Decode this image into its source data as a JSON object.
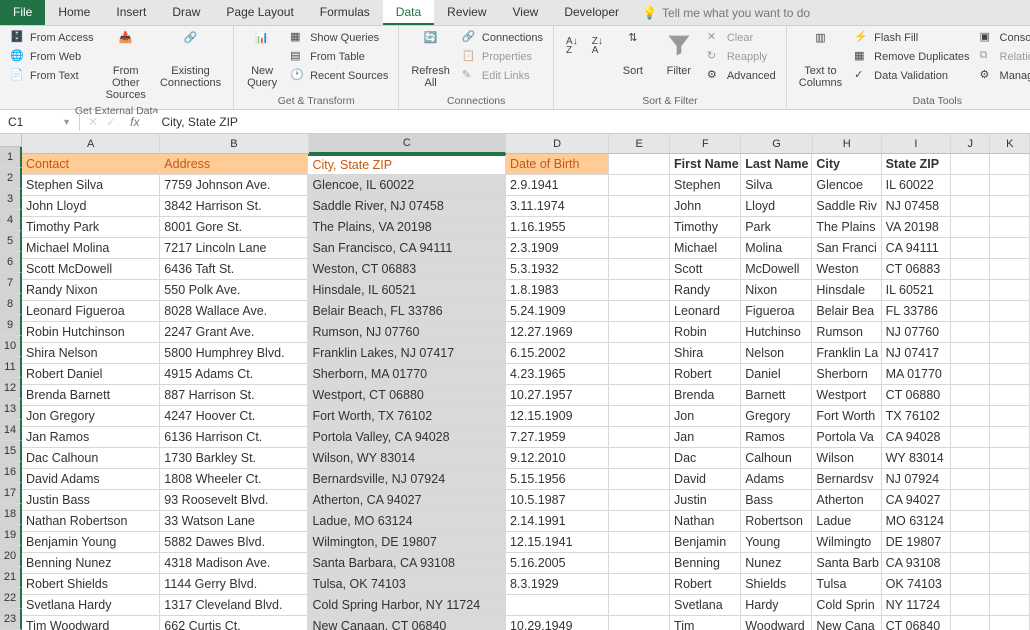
{
  "tabs": {
    "file": "File",
    "home": "Home",
    "insert": "Insert",
    "draw": "Draw",
    "pageLayout": "Page Layout",
    "formulas": "Formulas",
    "data": "Data",
    "review": "Review",
    "view": "View",
    "developer": "Developer",
    "tellMe": "Tell me what you want to do"
  },
  "ribbon": {
    "getExternal": {
      "label": "Get External Data",
      "fromAccess": "From Access",
      "fromWeb": "From Web",
      "fromText": "From Text",
      "fromOther": "From Other\nSources",
      "existing": "Existing\nConnections"
    },
    "getTransform": {
      "label": "Get & Transform",
      "newQuery": "New\nQuery",
      "showQueries": "Show Queries",
      "fromTable": "From Table",
      "recentSources": "Recent Sources"
    },
    "connections": {
      "label": "Connections",
      "refresh": "Refresh\nAll",
      "conn": "Connections",
      "props": "Properties",
      "editLinks": "Edit Links"
    },
    "sortFilter": {
      "label": "Sort & Filter",
      "sort": "Sort",
      "filter": "Filter",
      "clear": "Clear",
      "reapply": "Reapply",
      "advanced": "Advanced"
    },
    "dataTools": {
      "label": "Data Tools",
      "textToColumns": "Text to\nColumns",
      "flashFill": "Flash Fill",
      "removeDup": "Remove Duplicates",
      "validation": "Data Validation",
      "consolidate": "Consolidate",
      "relationships": "Relationships",
      "manage": "Manage Data M"
    }
  },
  "nameBox": "C1",
  "formulaBar": "City, State ZIP",
  "columns": [
    "A",
    "B",
    "C",
    "D",
    "E",
    "F",
    "G",
    "H",
    "I",
    "J",
    "K"
  ],
  "headers": {
    "contact": "Contact",
    "address": "Address",
    "cityStateZip": "City, State ZIP",
    "dob": "Date of Birth",
    "firstName": "First Name",
    "lastName": "Last Name",
    "city": "City",
    "stateZip": "State ZIP"
  },
  "rows": [
    {
      "n": 2,
      "A": "Stephen Silva",
      "B": "7759 Johnson Ave.",
      "C": "Glencoe, IL  60022",
      "D": "2.9.1941",
      "F": "Stephen",
      "G": "Silva",
      "H": "Glencoe",
      "I": "IL  60022"
    },
    {
      "n": 3,
      "A": "John Lloyd",
      "B": "3842 Harrison St.",
      "C": "Saddle River, NJ  07458",
      "D": "3.11.1974",
      "F": "John",
      "G": "Lloyd",
      "H": "Saddle Riv",
      "I": "NJ  07458"
    },
    {
      "n": 4,
      "A": "Timothy Park",
      "B": "8001 Gore St.",
      "C": "The Plains, VA  20198",
      "D": "1.16.1955",
      "F": "Timothy",
      "G": "Park",
      "H": "The Plains",
      "I": "VA  20198"
    },
    {
      "n": 5,
      "A": "Michael Molina",
      "B": "7217 Lincoln Lane",
      "C": "San Francisco, CA  94111",
      "D": "2.3.1909",
      "F": "Michael",
      "G": "Molina",
      "H": "San Franci",
      "I": "CA  94111"
    },
    {
      "n": 6,
      "A": "Scott McDowell",
      "B": "6436 Taft St.",
      "C": "Weston, CT  06883",
      "D": "5.3.1932",
      "F": "Scott",
      "G": "McDowell",
      "H": "Weston",
      "I": "CT  06883"
    },
    {
      "n": 7,
      "A": "Randy Nixon",
      "B": "550 Polk Ave.",
      "C": "Hinsdale, IL  60521",
      "D": "1.8.1983",
      "F": "Randy",
      "G": "Nixon",
      "H": "Hinsdale",
      "I": "IL  60521"
    },
    {
      "n": 8,
      "A": "Leonard Figueroa",
      "B": "8028 Wallace Ave.",
      "C": "Belair Beach, FL  33786",
      "D": "5.24.1909",
      "F": "Leonard",
      "G": "Figueroa",
      "H": "Belair Bea",
      "I": "FL  33786"
    },
    {
      "n": 9,
      "A": "Robin Hutchinson",
      "B": "2247 Grant Ave.",
      "C": "Rumson, NJ  07760",
      "D": "12.27.1969",
      "F": "Robin",
      "G": "Hutchinso",
      "H": "Rumson",
      "I": "NJ  07760"
    },
    {
      "n": 10,
      "A": "Shira Nelson",
      "B": "5800 Humphrey Blvd.",
      "C": "Franklin Lakes, NJ  07417",
      "D": "6.15.2002",
      "F": "Shira",
      "G": "Nelson",
      "H": "Franklin La",
      "I": "NJ  07417"
    },
    {
      "n": 11,
      "A": "Robert Daniel",
      "B": "4915 Adams Ct.",
      "C": "Sherborn, MA  01770",
      "D": "4.23.1965",
      "F": "Robert",
      "G": "Daniel",
      "H": "Sherborn",
      "I": "MA  01770"
    },
    {
      "n": 12,
      "A": "Brenda Barnett",
      "B": "887 Harrison St.",
      "C": "Westport, CT  06880",
      "D": "10.27.1957",
      "F": "Brenda",
      "G": "Barnett",
      "H": "Westport",
      "I": "CT  06880"
    },
    {
      "n": 13,
      "A": "Jon Gregory",
      "B": "4247 Hoover Ct.",
      "C": "Fort Worth, TX  76102",
      "D": "12.15.1909",
      "F": "Jon",
      "G": "Gregory",
      "H": "Fort Worth",
      "I": "TX  76102"
    },
    {
      "n": 14,
      "A": "Jan Ramos",
      "B": "6136 Harrison Ct.",
      "C": "Portola Valley, CA  94028",
      "D": "7.27.1959",
      "F": "Jan",
      "G": "Ramos",
      "H": "Portola Va",
      "I": "CA  94028"
    },
    {
      "n": 15,
      "A": "Dac Calhoun",
      "B": "1730 Barkley St.",
      "C": "Wilson, WY  83014",
      "D": "9.12.2010",
      "F": "Dac",
      "G": "Calhoun",
      "H": "Wilson",
      "I": "WY  83014"
    },
    {
      "n": 16,
      "A": "David Adams",
      "B": "1808 Wheeler Ct.",
      "C": "Bernardsville, NJ  07924",
      "D": "5.15.1956",
      "F": "David",
      "G": "Adams",
      "H": "Bernardsv",
      "I": "NJ  07924"
    },
    {
      "n": 17,
      "A": "Justin Bass",
      "B": "93 Roosevelt Blvd.",
      "C": "Atherton, CA  94027",
      "D": "10.5.1987",
      "F": "Justin",
      "G": "Bass",
      "H": "Atherton",
      "I": "CA  94027"
    },
    {
      "n": 18,
      "A": "Nathan Robertson",
      "B": "33 Watson Lane",
      "C": "Ladue, MO  63124",
      "D": "2.14.1991",
      "F": "Nathan",
      "G": "Robertson",
      "H": "Ladue",
      "I": "MO  63124"
    },
    {
      "n": 19,
      "A": "Benjamin Young",
      "B": "5882 Dawes Blvd.",
      "C": "Wilmington, DE  19807",
      "D": "12.15.1941",
      "F": "Benjamin",
      "G": "Young",
      "H": "Wilmingto",
      "I": "DE  19807"
    },
    {
      "n": 20,
      "A": "Benning Nunez",
      "B": "4318 Madison Ave.",
      "C": "Santa Barbara, CA  93108",
      "D": "5.16.2005",
      "F": "Benning",
      "G": "Nunez",
      "H": "Santa Barb",
      "I": "CA  93108"
    },
    {
      "n": 21,
      "A": "Robert Shields",
      "B": "1144 Gerry Blvd.",
      "C": "Tulsa, OK  74103",
      "D": "8.3.1929",
      "F": "Robert",
      "G": "Shields",
      "H": "Tulsa",
      "I": "OK  74103"
    },
    {
      "n": 22,
      "A": "Svetlana Hardy",
      "B": "1317 Cleveland Blvd.",
      "C": "Cold Spring Harbor, NY  11724",
      "D": "",
      "F": "Svetlana",
      "G": "Hardy",
      "H": "Cold Sprin",
      "I": "NY  11724"
    },
    {
      "n": 23,
      "A": "Tim Woodward",
      "B": "662 Curtis Ct.",
      "C": "New Canaan, CT  06840",
      "D": "10.29.1949",
      "F": "Tim",
      "G": "Woodward",
      "H": "New Cana",
      "I": "CT  06840"
    }
  ]
}
